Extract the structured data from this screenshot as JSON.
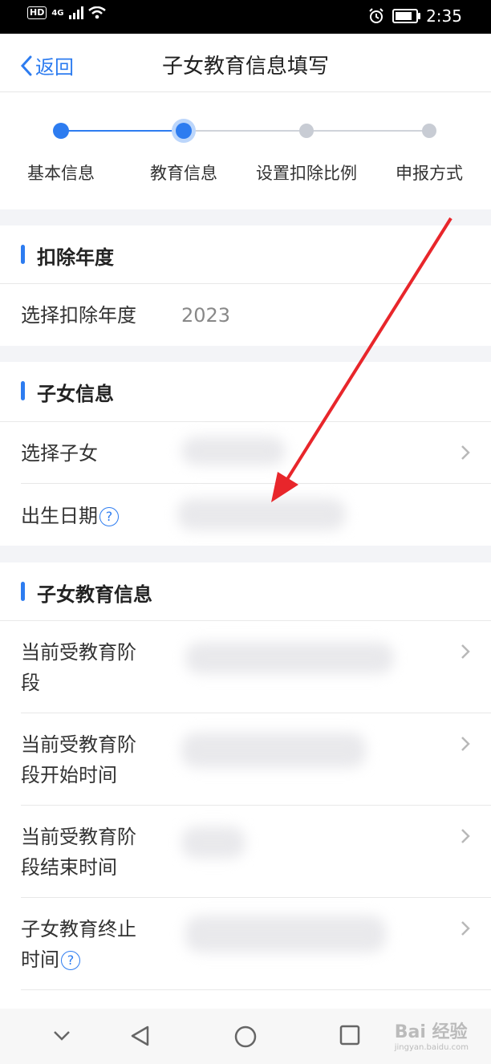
{
  "status": {
    "network": "4G",
    "hd": "HD",
    "time": "2:35"
  },
  "nav": {
    "back_label": "返回",
    "title": "子女教育信息填写"
  },
  "steps": [
    {
      "label": "基本信息",
      "state": "done"
    },
    {
      "label": "教育信息",
      "state": "active"
    },
    {
      "label": "设置扣除比例",
      "state": "todo"
    },
    {
      "label": "申报方式",
      "state": "todo"
    }
  ],
  "deduction": {
    "title": "扣除年度",
    "year_label": "选择扣除年度",
    "year_value": "2023"
  },
  "child": {
    "title": "子女信息",
    "select_label": "选择子女",
    "birth_label": "出生日期",
    "help": "?"
  },
  "edu": {
    "title": "子女教育信息",
    "stage_label": "当前受教育阶段",
    "stage_label_l1": "当前受教育阶",
    "stage_label_l2": "段",
    "start_label_l1": "当前受教育阶",
    "start_label_l2": "段开始时间",
    "end_label_l1": "当前受教育阶",
    "end_label_l2": "段结束时间",
    "stop_label_l1": "子女教育终止",
    "stop_label_l2": "时间",
    "help": "?"
  },
  "watermark": {
    "brand": "Bai 经验",
    "url": "jingyan.baidu.com"
  },
  "colors": {
    "accent": "#2d7cf0",
    "arrow": "#e8262b"
  }
}
